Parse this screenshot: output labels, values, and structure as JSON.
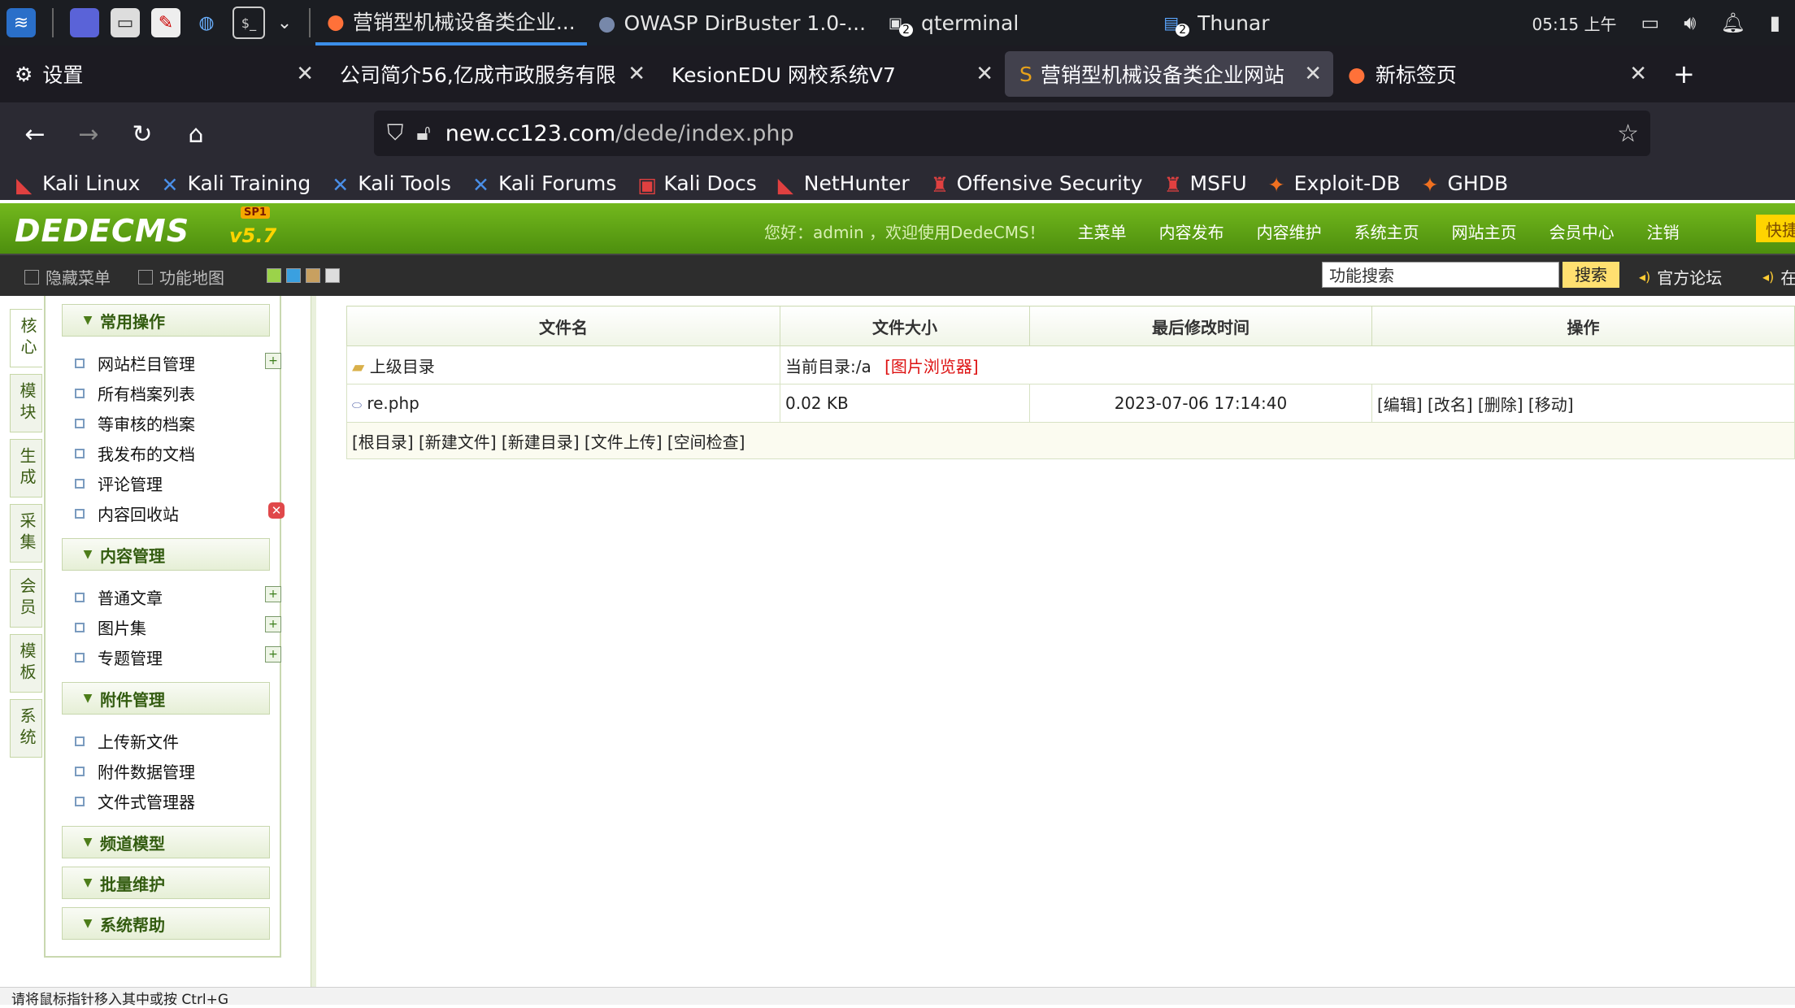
{
  "taskbar": {
    "windows": [
      {
        "title": "营销型机械设备类企业...",
        "active": true
      },
      {
        "title": "OWASP DirBuster 1.0-...",
        "active": false
      },
      {
        "title": "qterminal",
        "active": false
      },
      {
        "title": "Thunar",
        "active": false
      }
    ],
    "badge_qterminal": "2",
    "badge_thunar": "2",
    "clock": "05:15 上午"
  },
  "browser": {
    "tabs": [
      {
        "label": "设置"
      },
      {
        "label": "公司简介56,亿成市政服务有限"
      },
      {
        "label": "KesionEDU 网校系统V7"
      },
      {
        "label": "营销型机械设备类企业网站"
      },
      {
        "label": "新标签页"
      }
    ],
    "new_tab": "+",
    "url_domain": "new.cc123.com",
    "url_path": "/dede/index.php",
    "bookmarks": [
      "Kali Linux",
      "Kali Training",
      "Kali Tools",
      "Kali Forums",
      "Kali Docs",
      "NetHunter",
      "Offensive Security",
      "MSFU",
      "Exploit-DB",
      "GHDB"
    ]
  },
  "dede": {
    "logo": "DEDECMS",
    "version": "v5.7",
    "sp": "SP1",
    "welcome": "您好：admin ，欢迎使用DedeCMS！",
    "topnav": [
      "主菜单",
      "内容发布",
      "内容维护",
      "系统主页",
      "网站主页",
      "会员中心",
      "注销"
    ],
    "quick": "快捷",
    "toolbar": {
      "hide_menu": "隐藏菜单",
      "func_map": "功能地图",
      "search_placeholder": "功能搜索",
      "search_button": "搜索",
      "forum": "官方论坛",
      "online": "在"
    },
    "vtabs": [
      "核心",
      "模块",
      "生成",
      "采集",
      "会员",
      "模板",
      "系统"
    ],
    "groups": [
      {
        "title": "常用操作",
        "items": [
          "网站栏目管理",
          "所有档案列表",
          "等审核的档案",
          "我发布的文档",
          "评论管理",
          "内容回收站"
        ]
      },
      {
        "title": "内容管理",
        "items": [
          "普通文章",
          "图片集",
          "专题管理"
        ]
      },
      {
        "title": "附件管理",
        "items": [
          "上传新文件",
          "附件数据管理",
          "文件式管理器"
        ]
      },
      {
        "title": "频道模型",
        "items": []
      },
      {
        "title": "批量维护",
        "items": []
      },
      {
        "title": "系统帮助",
        "items": []
      }
    ],
    "file_table": {
      "headers": [
        "文件名",
        "文件大小",
        "最后修改时间",
        "操作"
      ],
      "parent_label": "上级目录",
      "current_dir": "当前目录:/a",
      "image_browser": "[图片浏览器]",
      "rows": [
        {
          "name": "re.php",
          "size": "0.02 KB",
          "mtime": "2023-07-06 17:14:40",
          "ops": "[编辑] [改名] [删除] [移动]"
        }
      ],
      "footer_actions": "[根目录] [新建文件] [新建目录] [文件上传] [空间检查]"
    }
  },
  "statusbar": {
    "text": "请将鼠标指针移入其中或按 Ctrl+G"
  }
}
